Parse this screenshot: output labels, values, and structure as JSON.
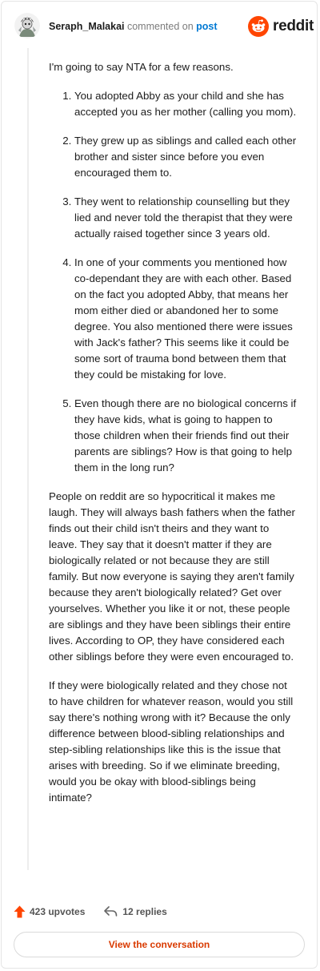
{
  "header": {
    "username": "Seraph_Malakai",
    "commented_text": "commented on",
    "post_link": "post",
    "brand": "reddit"
  },
  "comment": {
    "intro": "I'm going to say NTA for a few reasons.",
    "points": [
      "You adopted Abby as your child and she has accepted you as her mother (calling you mom).",
      "They grew up as siblings and called each other brother and sister since before you even encouraged them to.",
      "They went to relationship counselling but they lied and never told the therapist that they were actually raised together since 3 years old.",
      "In one of your comments you mentioned how co-dependant they are with each other. Based on the fact you adopted Abby, that means her mom either died or abandoned her to some degree. You also mentioned there were issues with Jack's father? This seems like it could be some sort of trauma bond between them that they could be mistaking for love.",
      "Even though there are no biological concerns if they have kids, what is going to happen to those children when their friends find out their parents are siblings? How is that going to help them in the long run?"
    ],
    "paragraph_2": "People on reddit are so hypocritical it makes me laugh. They will always bash fathers when the father finds out their child isn't theirs and they want to leave. They say that it doesn't matter if they are biologically related or not because they are still family. But now everyone is saying they aren't family because they aren't biologically related? Get over yourselves. Whether you like it or not, these people are siblings and they have been siblings their entire lives. According to OP, they have considered each other siblings before they were even encouraged to.",
    "paragraph_3": "If they were biologically related and they chose not to have children for whatever reason, would you still say there's nothing wrong with it? Because the only difference between blood-sibling relationships and step-sibling relationships like this is the issue that arises with breeding. So if we eliminate breeding, would you be okay with blood-siblings being intimate?"
  },
  "footer": {
    "upvotes": "423 upvotes",
    "replies": "12 replies",
    "view_button": "View the conversation"
  },
  "colors": {
    "upvote": "#ff4500",
    "link": "#0079d3",
    "button_text": "#d93a00"
  },
  "icons": {
    "upvote": "upvote-arrow-icon",
    "reply": "reply-arrow-icon",
    "brand": "reddit-snoo-icon",
    "avatar": "user-avatar"
  }
}
